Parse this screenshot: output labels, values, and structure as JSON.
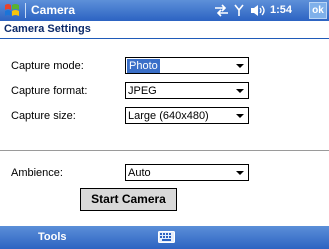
{
  "titlebar": {
    "title": "Camera",
    "time": "1:54",
    "ok_label": "ok",
    "icons": [
      "windows-start-icon",
      "connectivity-icon",
      "signal-antenna-icon",
      "volume-icon"
    ]
  },
  "header": {
    "title": "Camera Settings"
  },
  "settings": {
    "capture_mode": {
      "label": "Capture mode:",
      "value": "Photo"
    },
    "capture_format": {
      "label": "Capture format:",
      "value": "JPEG"
    },
    "capture_size": {
      "label": "Capture size:",
      "value": "Large (640x480)"
    },
    "ambience": {
      "label": "Ambience:",
      "value": "Auto"
    }
  },
  "start_button": {
    "label": "Start Camera"
  },
  "menubar": {
    "tools_label": "Tools",
    "icons": [
      "keyboard-icon"
    ]
  },
  "colors": {
    "titlebar": "#2c63c2",
    "header_text": "#0c2a6a",
    "selection": "#3a6fc8"
  }
}
